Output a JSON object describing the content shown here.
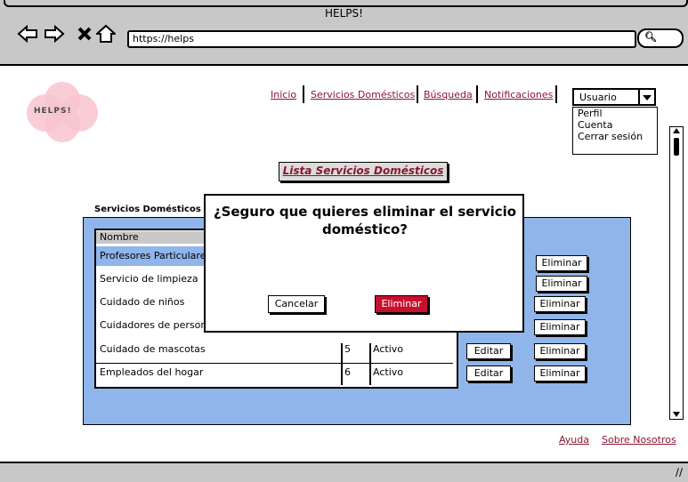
{
  "window": {
    "title": "HELPS!"
  },
  "toolbar": {
    "url": "https://helps"
  },
  "logo": {
    "brand": "HELPS!"
  },
  "nav": {
    "items": [
      "Inicio",
      "Servicios Domésticos",
      "Búsqueda",
      "Notificaciones"
    ]
  },
  "user_menu": {
    "selected": "Usuario",
    "options": [
      "Perfil",
      "Cuenta",
      "Cerrar sesión"
    ]
  },
  "page": {
    "title": "Lista Servicios Domésticos",
    "section_label": "Servicios Domésticos"
  },
  "table": {
    "header": "Nombre",
    "rows": [
      {
        "name": "Profesores Particulares",
        "id": "",
        "status": ""
      },
      {
        "name": "Servicio de limpieza",
        "id": "",
        "status": ""
      },
      {
        "name": "Cuidado de niños",
        "id": "",
        "status": ""
      },
      {
        "name": "Cuidadores de person",
        "id": "",
        "status": ""
      },
      {
        "name": "Cuidado de mascotas",
        "id": "5",
        "status": "Activo"
      },
      {
        "name": "Empleados del hogar",
        "id": "6",
        "status": "Activo"
      }
    ],
    "edit_label": "Editar",
    "delete_label": "Eliminar"
  },
  "modal": {
    "question": "¿Seguro que quieres eliminar el servicio doméstico?",
    "cancel_label": "Cancelar",
    "confirm_label": "Eliminar"
  },
  "footer": {
    "links": [
      "Ayuda",
      "Sobre Nosotros"
    ]
  },
  "colors": {
    "accent": "#8a1630",
    "panel": "#8fb5ea",
    "danger": "#c8102e",
    "selected_row": "#8fb5ea"
  }
}
